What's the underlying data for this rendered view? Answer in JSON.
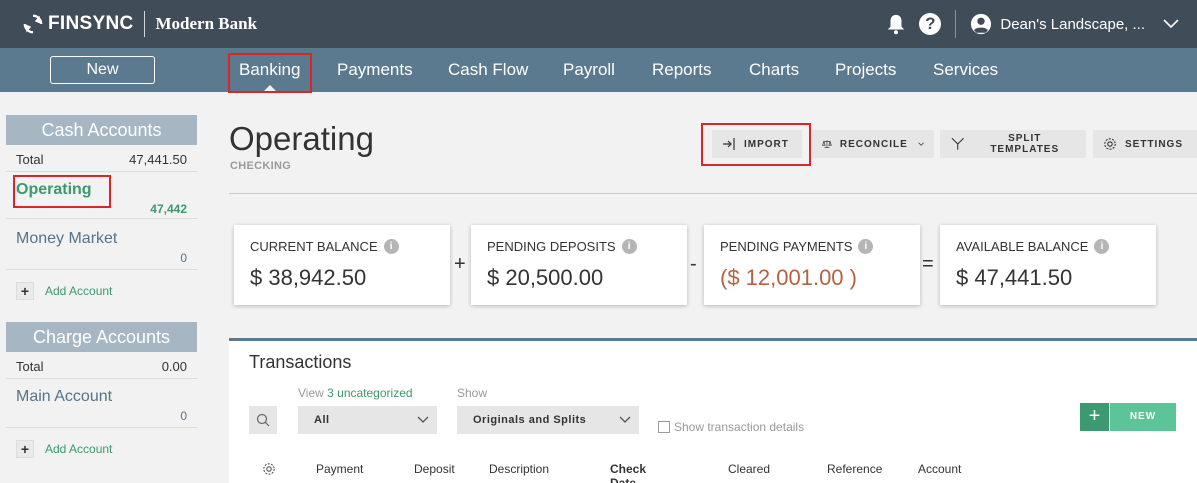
{
  "header": {
    "logo_text": "FINSYNC",
    "bank_name": "Modern Bank",
    "help_label": "?",
    "user_name": "Dean's Landscape, ..."
  },
  "nav": {
    "new_label": "New",
    "items": [
      "Banking",
      "Payments",
      "Cash Flow",
      "Payroll",
      "Reports",
      "Charts",
      "Projects",
      "Services"
    ],
    "active": "Banking"
  },
  "sidebar": {
    "cash": {
      "title": "Cash Accounts",
      "total_label": "Total",
      "total_value": "47,441.50",
      "accounts": [
        {
          "name": "Operating",
          "value": "47,442"
        },
        {
          "name": "Money Market",
          "value": "0"
        }
      ],
      "add_label": "Add Account"
    },
    "charge": {
      "title": "Charge Accounts",
      "total_label": "Total",
      "total_value": "0.00",
      "accounts": [
        {
          "name": "Main Account",
          "value": "0"
        }
      ],
      "add_label": "Add Account"
    }
  },
  "main": {
    "title": "Operating",
    "subtitle": "CHECKING",
    "toolbar": {
      "import": "IMPORT",
      "reconcile": "RECONCILE",
      "split_templates": "SPLIT TEMPLATES",
      "settings": "SETTINGS"
    },
    "cards": [
      {
        "label": "CURRENT BALANCE",
        "value": "$ 38,942.50"
      },
      {
        "label": "PENDING DEPOSITS",
        "value": "$ 20,500.00"
      },
      {
        "label": "PENDING PAYMENTS",
        "value": "($ 12,001.00 )"
      },
      {
        "label": "AVAILABLE BALANCE",
        "value": "$ 47,441.50"
      }
    ],
    "operators": [
      "+",
      "-",
      "="
    ],
    "info_glyph": "i"
  },
  "transactions": {
    "title": "Transactions",
    "view_prefix": "View ",
    "view_link": "3 uncategorized",
    "show_label": "Show",
    "filter_value": "All",
    "show_value": "Originals and Splits",
    "details_label": "Show transaction details",
    "add_plus": "+",
    "new_label": "NEW",
    "columns": [
      "Payment",
      "Deposit",
      "Description",
      "Check Date",
      "Cleared",
      "Reference",
      "Account"
    ]
  },
  "colors": {
    "topbar": "#414c59",
    "navbar": "#5b7a8f",
    "accent_green": "#3a9a6e",
    "negative": "#b5623f",
    "highlight": "#d9262b"
  }
}
